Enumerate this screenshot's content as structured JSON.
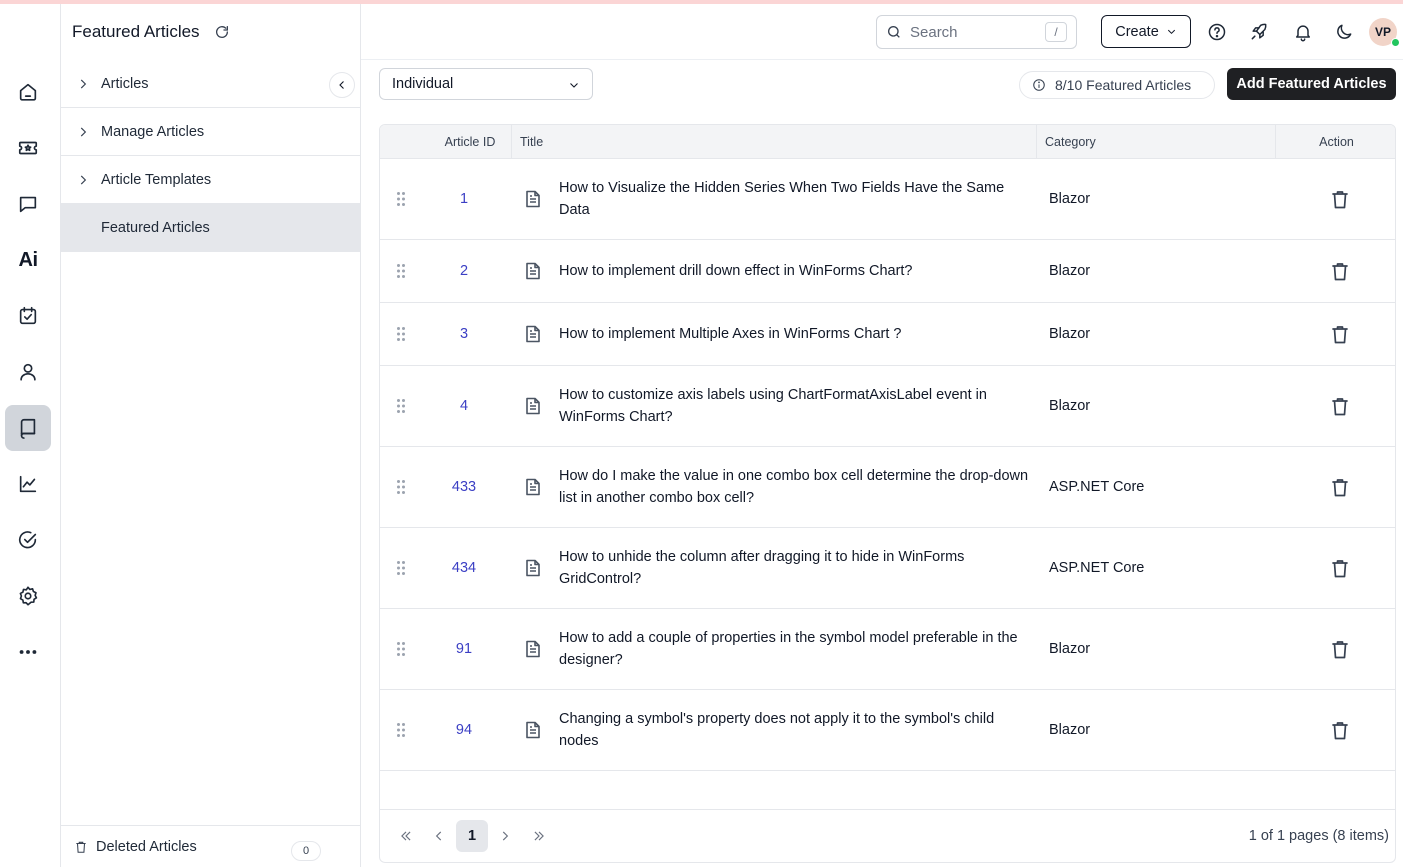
{
  "nav": {
    "title": "Featured Articles",
    "items": [
      {
        "label": "Articles",
        "has_chevron": true
      },
      {
        "label": "Manage Articles",
        "has_chevron": true
      },
      {
        "label": "Article Templates",
        "has_chevron": true
      },
      {
        "label": "Featured Articles",
        "has_chevron": false,
        "active": true
      }
    ],
    "footer": {
      "label": "Deleted Articles",
      "count": "0"
    }
  },
  "rail": {
    "icons": [
      "home-icon",
      "ticket-icon",
      "chat-icon",
      "ai-icon",
      "tasks-icon",
      "contacts-icon",
      "knowledge-base-icon",
      "reports-icon",
      "approvals-icon",
      "settings-icon",
      "more-icon"
    ],
    "ai_label": "Ai",
    "active": "knowledge-base-icon"
  },
  "header": {
    "search_placeholder": "Search",
    "search_shortcut": "/",
    "create_label": "Create",
    "avatar_initials": "VP"
  },
  "toolbar": {
    "select_value": "Individual",
    "featured_count": "8/10 Featured Articles",
    "add_label": "Add Featured Articles"
  },
  "grid": {
    "columns": [
      "Article ID",
      "Title",
      "Category",
      "Action"
    ],
    "rows": [
      {
        "id": "1",
        "title": "How to Visualize the Hidden Series When Two Fields Have the Same Data",
        "category": "Blazor"
      },
      {
        "id": "2",
        "title": "How to implement drill down effect in WinForms Chart?",
        "category": "Blazor"
      },
      {
        "id": "3",
        "title": "How to implement Multiple Axes in WinForms Chart ?",
        "category": "Blazor"
      },
      {
        "id": "4",
        "title": "How to customize axis labels using ChartFormatAxisLabel event in WinForms Chart?",
        "category": "Blazor"
      },
      {
        "id": "433",
        "title": "How do I make the value in one combo box cell determine the drop-down list in another combo box cell?",
        "category": "ASP.NET Core"
      },
      {
        "id": "434",
        "title": "How to unhide the column after dragging it to hide in WinForms GridControl?",
        "category": "ASP.NET Core"
      },
      {
        "id": "91",
        "title": "How to add a couple of properties in the symbol model preferable in the designer?",
        "category": "Blazor"
      },
      {
        "id": "94",
        "title": "Changing a symbol's property does not apply it to the symbol's child nodes",
        "category": "Blazor"
      }
    ]
  },
  "pager": {
    "current_page": "1",
    "info": "1 of 1 pages (8 items)"
  }
}
